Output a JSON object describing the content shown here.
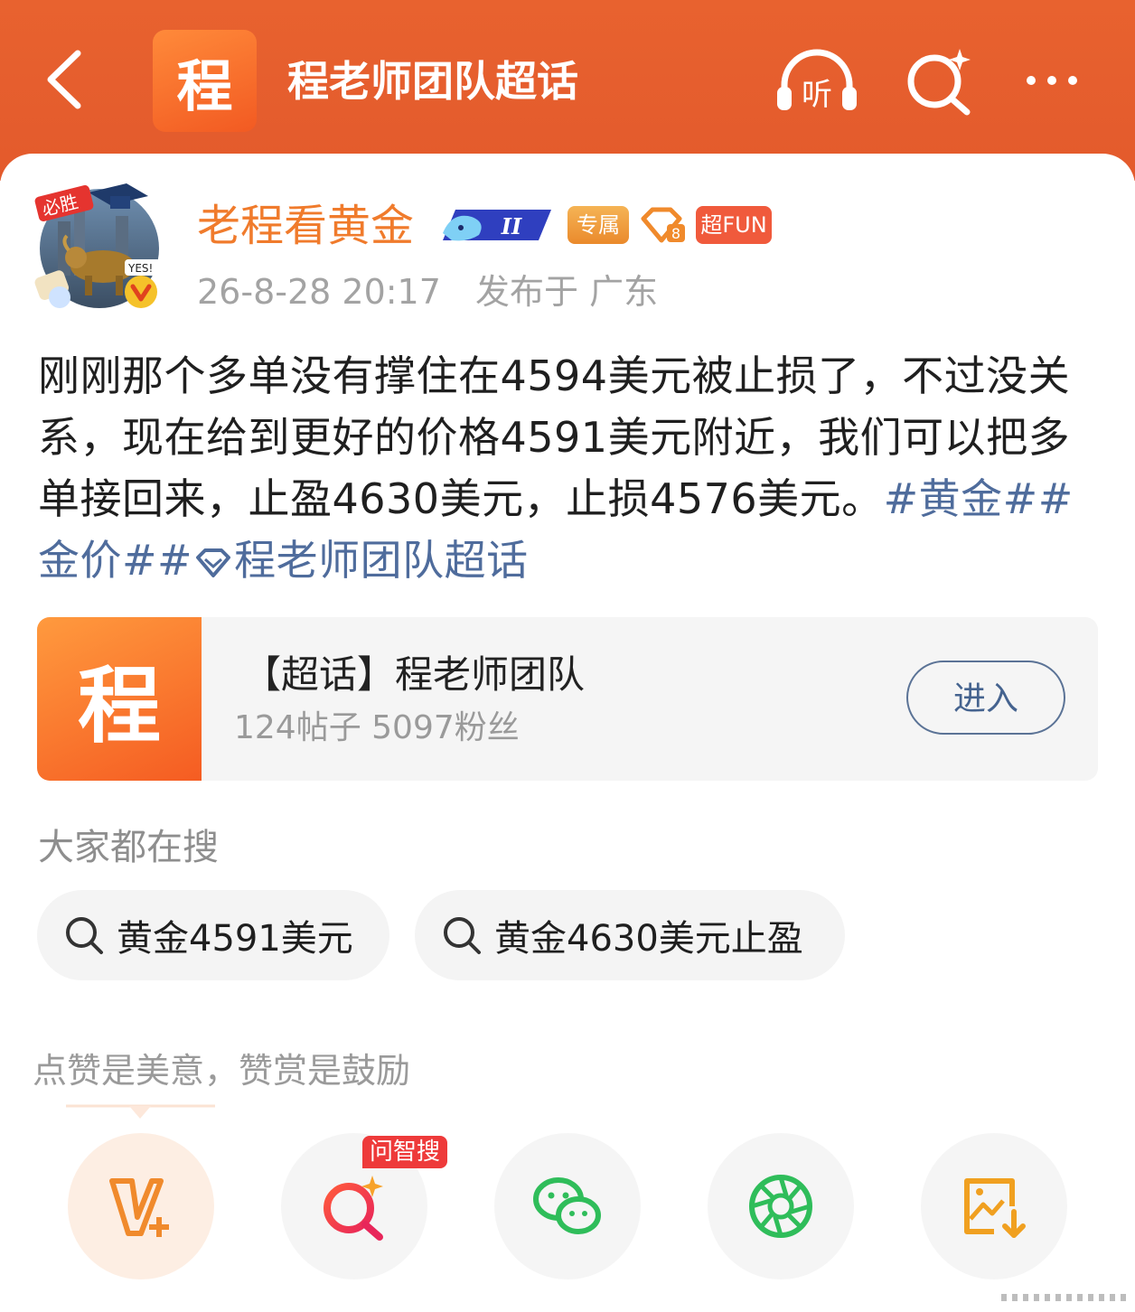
{
  "header": {
    "topic_logo_char": "程",
    "title": "程老师团队超话",
    "listen_label": "听"
  },
  "post": {
    "author": {
      "name": "老程看黄金",
      "badges": {
        "vip_level": "II",
        "exclusive": "专属",
        "fan_level": "8",
        "fun": "超FUN"
      },
      "avatar_tags": [
        "必胜",
        "YES!"
      ]
    },
    "time": "26-8-28 20:17",
    "location": "发布于 广东",
    "text_parts": [
      "刚刚那个多单没有撑住在4594美元被止损了，不过没关系，现在给到更好的价格4591美元附近，我们可以把多单接回来，止盈4630美元，止损4576美元。",
      "#黄金#",
      "#金价#",
      "程老师团队超话"
    ]
  },
  "topic_card": {
    "logo_char": "程",
    "title": "【超话】程老师团队",
    "stats": "124帖子 5097粉丝",
    "enter_label": "进入"
  },
  "searches": {
    "heading": "大家都在搜",
    "items": [
      "黄金4591美元",
      "黄金4630美元止盈"
    ]
  },
  "share": {
    "tip": "点赞是美意，赞赏是鼓励",
    "wzs_badge": "问智搜",
    "actions": [
      "v-plus-icon",
      "ai-search-icon",
      "wechat-icon",
      "moments-icon",
      "save-image-icon"
    ]
  },
  "colors": {
    "header_bg": "#e35a2c",
    "username": "#f07b2c",
    "topic_link": "#4f6c9c"
  }
}
